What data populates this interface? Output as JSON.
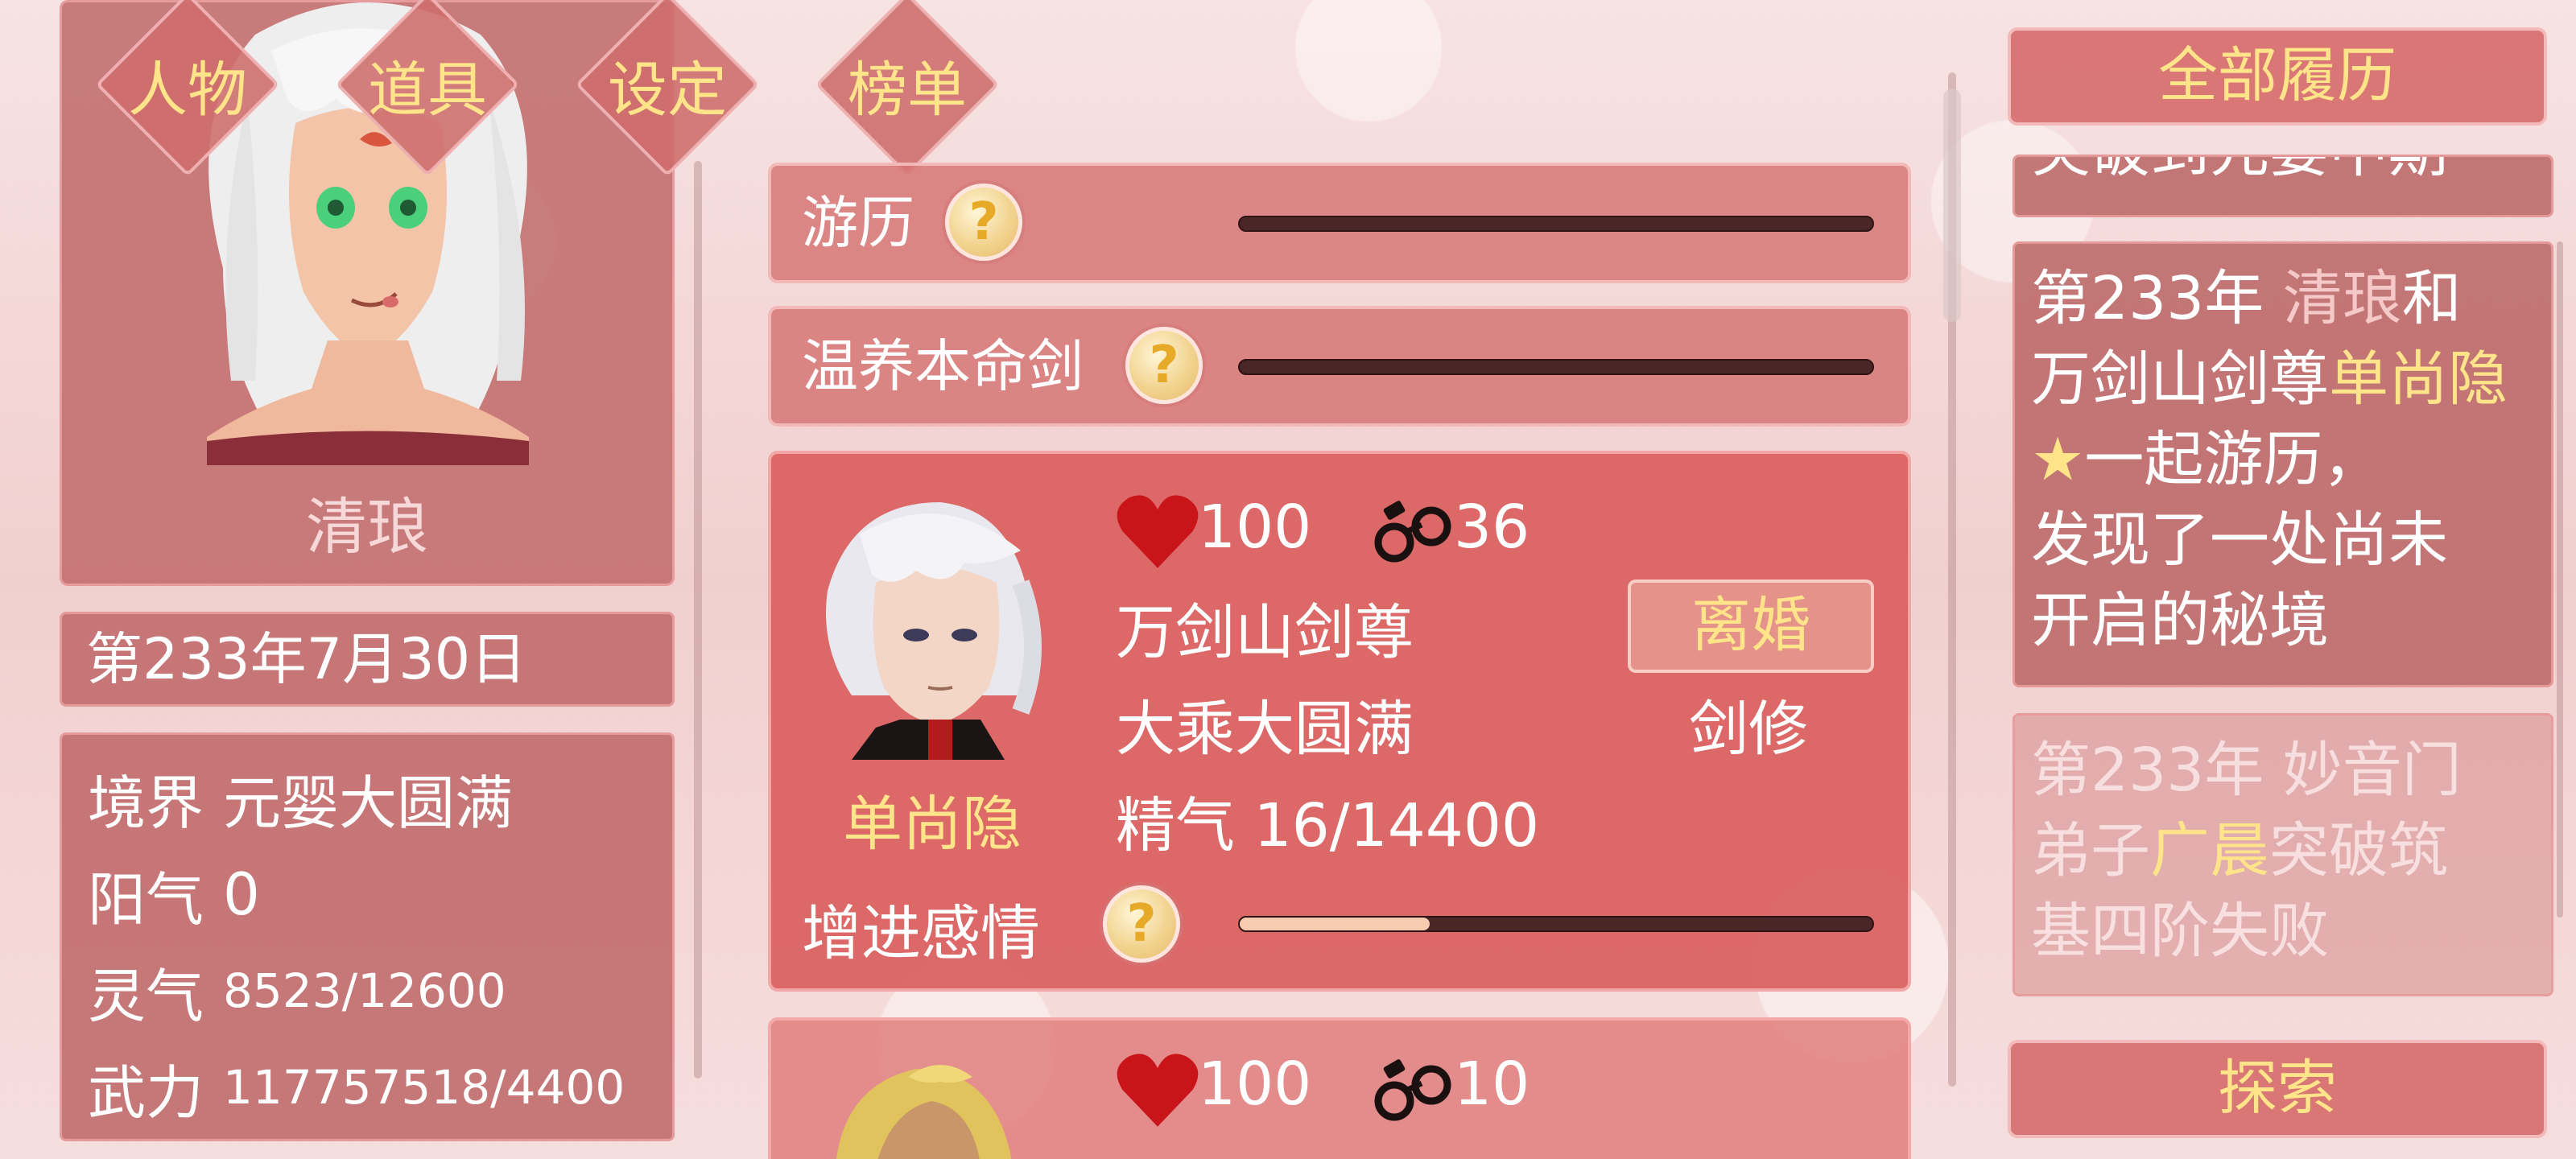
{
  "nav": {
    "tab_character": "人物",
    "tab_items": "道具",
    "tab_settings": "设定",
    "tab_ranking": "榜单"
  },
  "player": {
    "name": "清琅",
    "date": "第233年7月30日",
    "stats": [
      {
        "label": "境界",
        "value": "元婴大圆满"
      },
      {
        "label": "阳气",
        "value": "0"
      },
      {
        "label": "灵气",
        "value": "8523/12600"
      },
      {
        "label": "武力",
        "value": "117757518/4400"
      }
    ]
  },
  "tasks": [
    {
      "label": "游历",
      "help": "?",
      "progress": 0
    },
    {
      "label": "温养本命剑",
      "help": "?",
      "progress": 0
    }
  ],
  "companions": [
    {
      "name": "单尚隐",
      "affection": "100",
      "bond": "36",
      "sect_title": "万剑山剑尊",
      "realm": "大乘大圆满",
      "essence": "精气 16/14400",
      "divorce_label": "离婚",
      "class": "剑修",
      "action_label": "增进感情",
      "action_help": "?",
      "action_progress": 0.3
    },
    {
      "affection": "100",
      "bond": "10"
    }
  ],
  "log": {
    "header": "全部履历",
    "top_fragment": "突破到元婴中期",
    "entries": [
      {
        "year": "第233年",
        "a": "清琅",
        "mid1": "和",
        "mid2": "万剑山剑尊",
        "b": "单尚隐★",
        "rest1": "一起游历，",
        "rest2": "发现了一处尚未",
        "rest3": "开启的秘境"
      },
      {
        "year": "第233年",
        "mid1": "妙音门",
        "mid2": "弟子",
        "b": "广晨",
        "rest1": "突破筑",
        "rest2": "基四阶失败"
      }
    ],
    "explore_label": "探索"
  },
  "colors": {
    "gold_text": "#ffe48a",
    "panel": "#c16c6c",
    "card_active": "#d95c5c"
  }
}
